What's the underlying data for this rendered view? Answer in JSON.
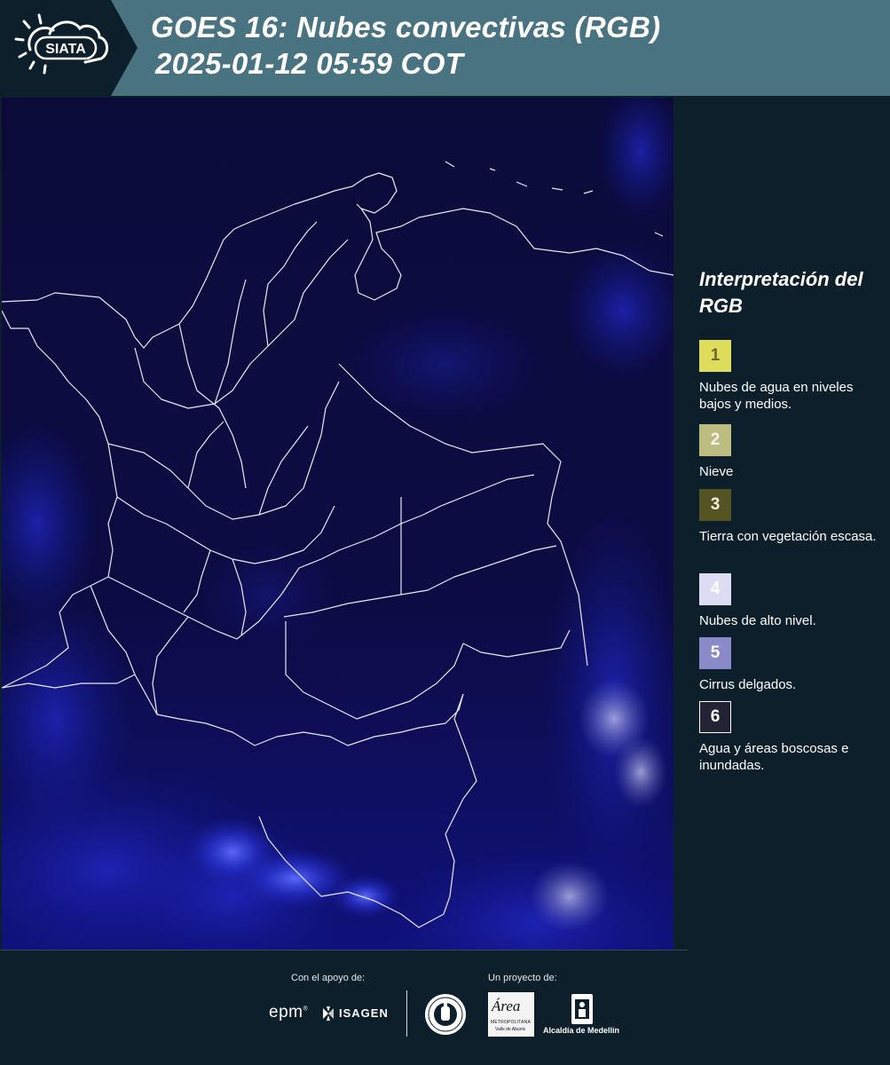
{
  "header": {
    "logo_text": "SIATA",
    "title_line1": "GOES 16: Nubes convectivas (RGB)",
    "title_line2": "2025-01-12 05:59 COT"
  },
  "legend": {
    "title": "Interpretación del RGB",
    "items": [
      {
        "number": "1",
        "label": "Nubes de agua en niveles bajos y medios.",
        "color": "#dede5c",
        "text_color": "#6b6a2a"
      },
      {
        "number": "2",
        "label": "Nieve",
        "color": "#bdbd82",
        "text_color": "#f4f4e8"
      },
      {
        "number": "3",
        "label": "Tierra con vegetación escasa.",
        "color": "#545422",
        "text_color": "#f1f1e0"
      },
      {
        "number": "4",
        "label": "Nubes de alto nivel.",
        "color": "#dcdcf4",
        "text_color": "#ffffff"
      },
      {
        "number": "5",
        "label": "Cirrus delgados.",
        "color": "#8a8ac8",
        "text_color": "#ffffff"
      },
      {
        "number": "6",
        "label": "Agua y áreas boscosas e inundadas.",
        "color": "#232336",
        "text_color": "#ffffff"
      }
    ]
  },
  "footer": {
    "support_label": "Con el apoyo de:",
    "project_label": "Un proyecto de:",
    "epm": "epm",
    "isagen": "ISAGEN",
    "area_main": "Área",
    "area_sub1": "METROPOLITANA",
    "area_sub2": "Valle de Aburrá",
    "alcaldia": "Alcaldía de Medellín"
  }
}
